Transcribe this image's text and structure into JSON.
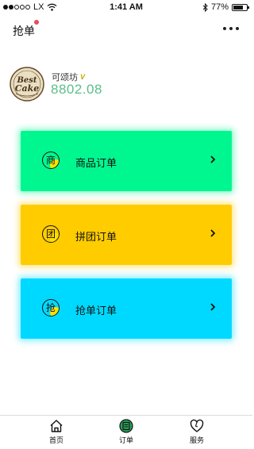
{
  "status_bar": {
    "carrier": "LX",
    "time": "1:41 AM",
    "battery_percent": "77%",
    "battery_level": 0.77,
    "signal_bars_filled": 2
  },
  "nav": {
    "title": "抢单",
    "notification_dot_color": "#e84a5f",
    "more_icon": "more-horizontal-icon"
  },
  "profile": {
    "logo_text_top": "Best",
    "logo_text_bottom": "Cake",
    "name": "可颂坊",
    "verified_badge": "V",
    "balance": "8802.08"
  },
  "cards": [
    {
      "label": "商品订单",
      "icon_glyph": "商",
      "color": "#00f78f",
      "glow": "rgba(0,247,143,0.45)"
    },
    {
      "label": "拼团订单",
      "icon_glyph": "团",
      "color": "#ffcc00",
      "glow": "rgba(255,204,0,0.45)"
    },
    {
      "label": "抢单订单",
      "icon_glyph": "抢",
      "color": "#00d9ff",
      "glow": "rgba(0,217,255,0.45)"
    }
  ],
  "tabs": [
    {
      "label": "首页",
      "icon": "home-icon"
    },
    {
      "label": "订单",
      "icon": "order-icon",
      "active": true,
      "active_color": "#27a35c"
    },
    {
      "label": "服务",
      "icon": "heart-service-icon"
    }
  ]
}
